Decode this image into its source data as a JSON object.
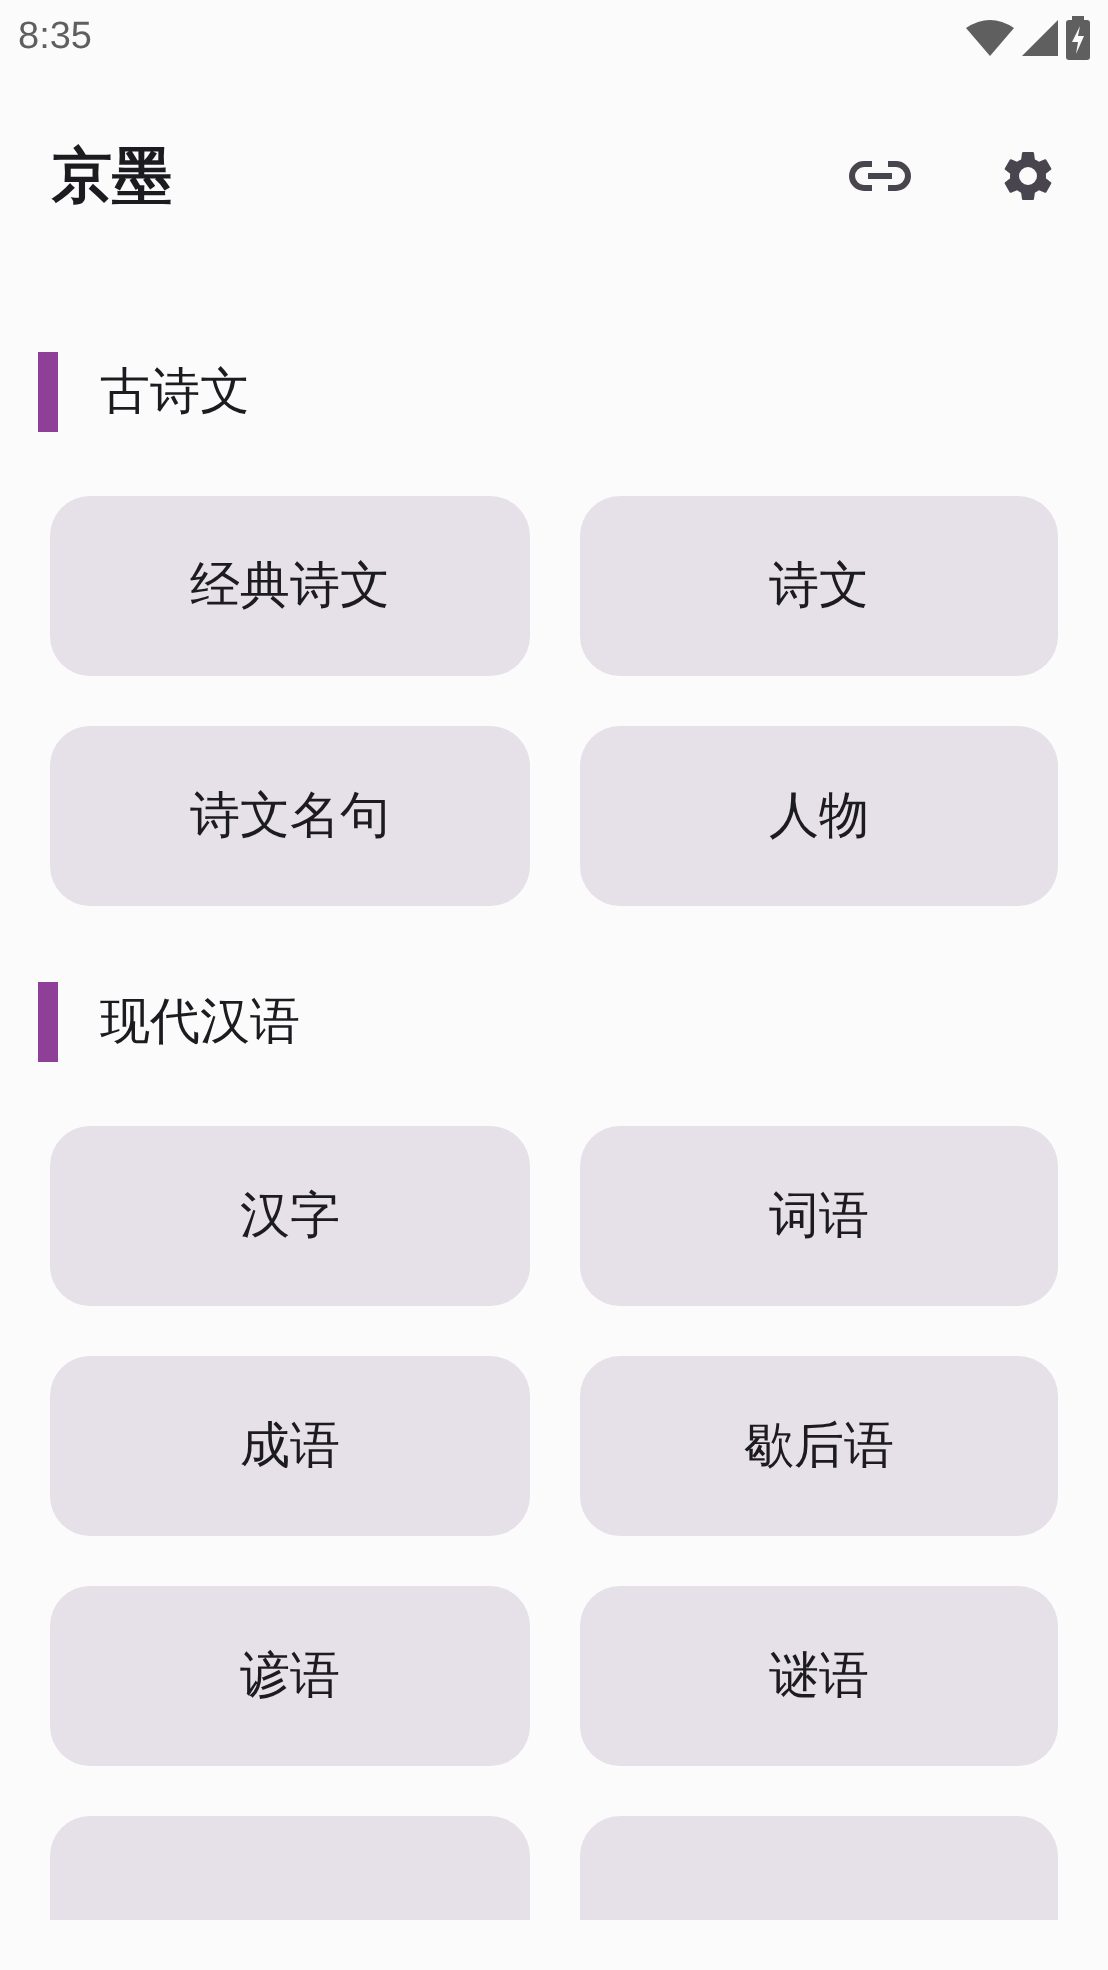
{
  "status_bar": {
    "time": "8:35"
  },
  "app_bar": {
    "title": "京墨"
  },
  "sections": [
    {
      "title": "古诗文",
      "buttons": [
        "经典诗文",
        "诗文",
        "诗文名句",
        "人物"
      ]
    },
    {
      "title": "现代汉语",
      "buttons": [
        "汉字",
        "词语",
        "成语",
        "歇后语",
        "谚语",
        "谜语"
      ]
    }
  ]
}
